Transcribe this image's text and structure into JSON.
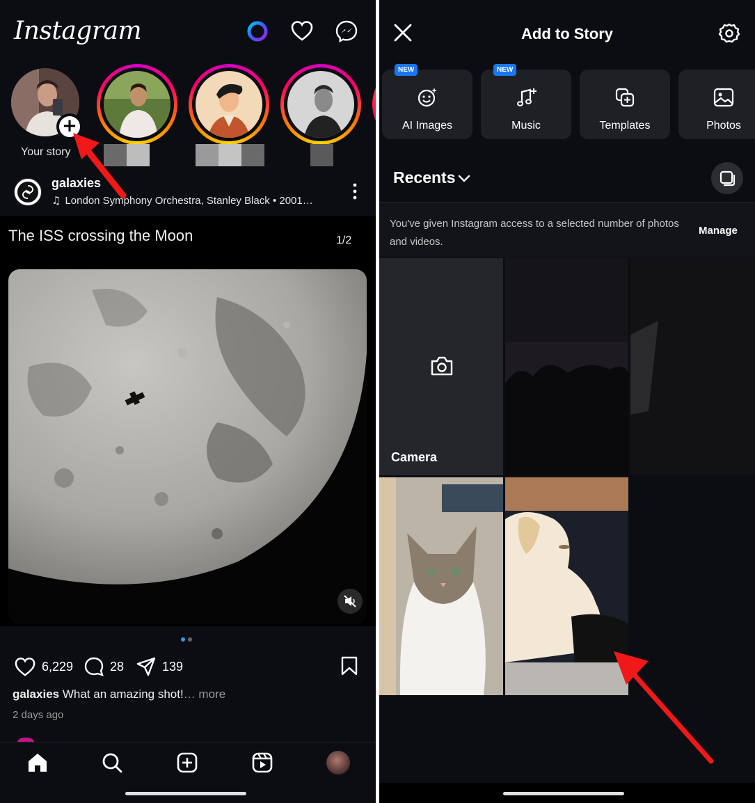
{
  "left": {
    "header": {
      "logo": "Instagram"
    },
    "stories": {
      "your_story_label": "Your story"
    },
    "post": {
      "username": "galaxies",
      "music": "London Symphony Orchestra, Stanley Black • 2001…",
      "title": "The ISS crossing the Moon",
      "page_indicator": "1/2",
      "likes": "6,229",
      "comments": "28",
      "shares": "139",
      "caption_user": "galaxies",
      "caption_text": " What an amazing shot!",
      "caption_more": "… more",
      "time_ago": "2 days ago"
    },
    "nav": [
      "home-icon",
      "search-icon",
      "create-icon",
      "reels-icon",
      "profile-avatar"
    ]
  },
  "right": {
    "title": "Add to Story",
    "tiles": [
      {
        "label": "AI Images",
        "badge": "NEW",
        "icon": "ai-images-icon"
      },
      {
        "label": "Music",
        "badge": "NEW",
        "icon": "music-icon"
      },
      {
        "label": "Templates",
        "badge": "",
        "icon": "templates-icon"
      },
      {
        "label": "Photos",
        "badge": "",
        "icon": "photos-icon"
      }
    ],
    "recents_label": "Recents",
    "access_text": "You've given Instagram access to a selected number of photos and videos.",
    "manage_label": "Manage",
    "camera_label": "Camera"
  },
  "colors": {
    "background": "#0b0d12",
    "accent_blue": "#1877f2",
    "annotation_red": "#f01818"
  }
}
